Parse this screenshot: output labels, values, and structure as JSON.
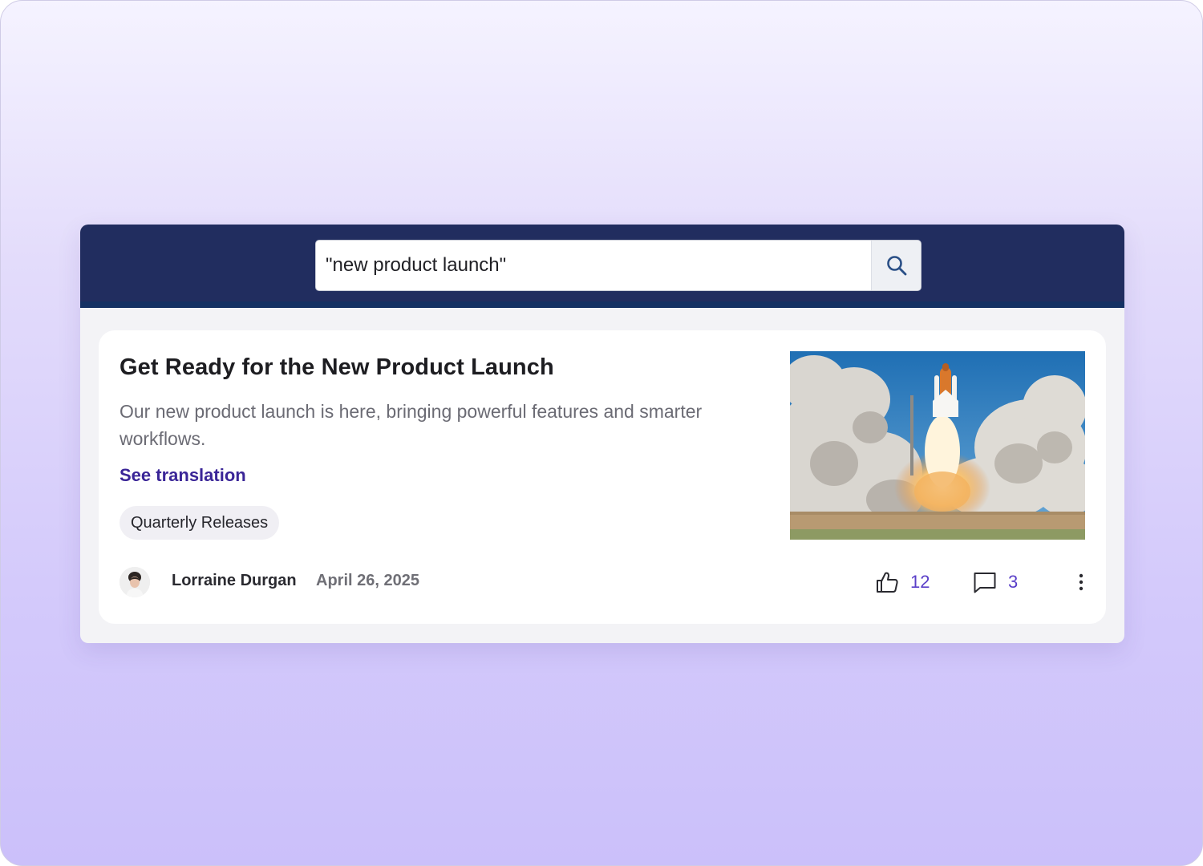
{
  "search": {
    "value": "\"new product launch\"",
    "button_icon": "search-icon"
  },
  "post": {
    "title": "Get Ready for the New Product Launch",
    "description": "Our new product launch is here, bringing powerful features and smarter workflows.",
    "translation_link": "See translation",
    "tag": "Quarterly Releases",
    "image_icon": "rocket-launch-photo",
    "author": "Lorraine Durgan",
    "date": "April 26, 2025",
    "likes": "12",
    "comments": "3",
    "like_icon": "thumbs-up-icon",
    "comment_icon": "comment-icon",
    "more_icon": "more-vertical-icon"
  },
  "colors": {
    "header_bg": "#212d5f",
    "accent": "#3a2597",
    "count_color": "#5a3fc8",
    "page_gradient_top": "#f5f3ff",
    "page_gradient_bottom": "#cbc0fa"
  }
}
